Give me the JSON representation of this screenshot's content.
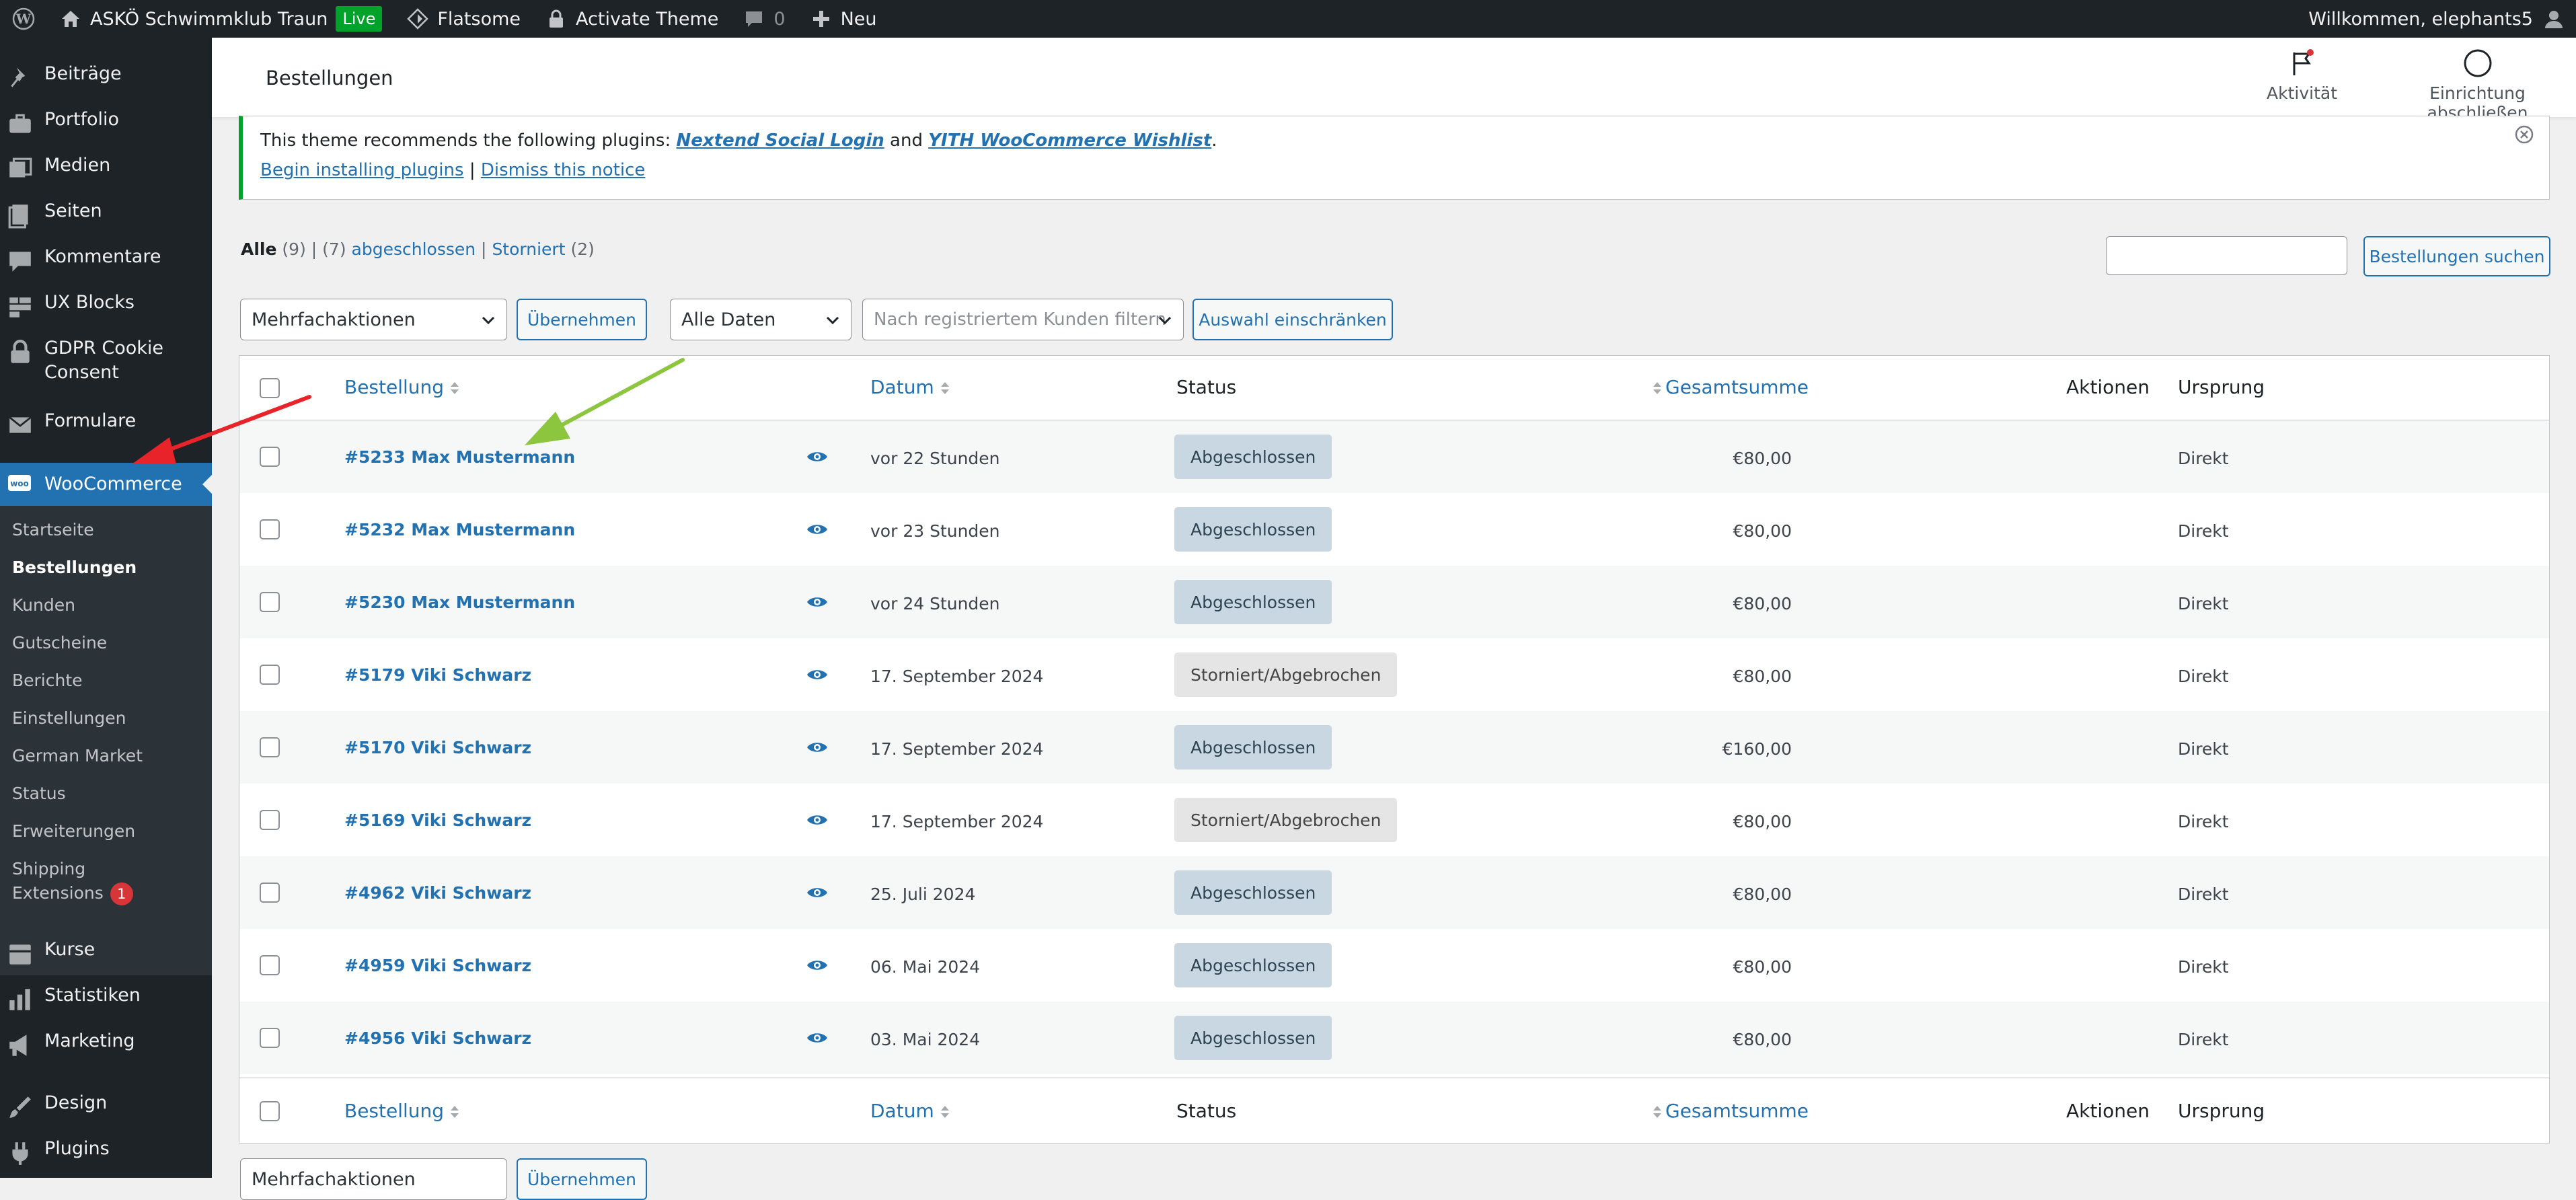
{
  "adminbar": {
    "site_name": "ASKÖ Schwimmklub Traun",
    "live_badge": "Live",
    "theme": "Flatsome",
    "activate_theme": "Activate Theme",
    "comments_count": "0",
    "new_label": "Neu",
    "welcome": "Willkommen, elephants5"
  },
  "sidebar": {
    "items_top": [
      {
        "label": "Beiträge",
        "icon": "pin-icon"
      },
      {
        "label": "Portfolio",
        "icon": "portfolio-icon"
      },
      {
        "label": "Medien",
        "icon": "media-icon"
      },
      {
        "label": "Seiten",
        "icon": "pages-icon"
      },
      {
        "label": "Kommentare",
        "icon": "comments-icon"
      },
      {
        "label": "UX Blocks",
        "icon": "blocks-icon"
      },
      {
        "label": "GDPR Cookie Consent",
        "icon": "lock-icon"
      },
      {
        "label": "Formulare",
        "icon": "mail-icon"
      }
    ],
    "active": {
      "label": "WooCommerce",
      "icon": "woo-icon"
    },
    "submenu": [
      {
        "label": "Startseite"
      },
      {
        "label": "Bestellungen"
      },
      {
        "label": "Kunden"
      },
      {
        "label": "Gutscheine"
      },
      {
        "label": "Berichte"
      },
      {
        "label": "Einstellungen"
      },
      {
        "label": "German Market"
      },
      {
        "label": "Status"
      },
      {
        "label": "Erweiterungen"
      },
      {
        "label": "Shipping Extensions",
        "badge": "1"
      }
    ],
    "items_bottom": [
      {
        "label": "Kurse",
        "icon": "courses-icon"
      },
      {
        "label": "Statistiken",
        "icon": "stats-icon"
      },
      {
        "label": "Marketing",
        "icon": "marketing-icon"
      },
      {
        "label": "Design",
        "icon": "brush-icon"
      },
      {
        "label": "Plugins",
        "icon": "plugin-icon"
      }
    ]
  },
  "header": {
    "title": "Bestellungen",
    "activity": "Aktivität",
    "setup": "Einrichtung abschließen"
  },
  "notice": {
    "text_before": "This theme recommends the following plugins: ",
    "plugin1": "Nextend Social Login",
    "text_and": " and ",
    "plugin2": "YITH WooCommerce Wishlist",
    "text_end": ".",
    "install_link": "Begin installing plugins",
    "separator": " | ",
    "dismiss_link": "Dismiss this notice"
  },
  "filters": {
    "all_label": "Alle",
    "all_count": "(9)",
    "sep": " | ",
    "completed_count": "(7)",
    "completed_label": "abgeschlossen",
    "cancelled_label": "Storniert",
    "cancelled_count": "(2)"
  },
  "search": {
    "button": "Bestellungen suchen",
    "value": ""
  },
  "toolbar": {
    "bulk": "Mehrfachaktionen",
    "apply": "Übernehmen",
    "dates": "Alle Daten",
    "customer_placeholder": "Nach registriertem Kunden filtern",
    "filter": "Auswahl einschränken"
  },
  "table": {
    "columns": {
      "order": "Bestellung",
      "date": "Datum",
      "status": "Status",
      "total": "Gesamtsumme",
      "actions": "Aktionen",
      "origin": "Ursprung"
    },
    "rows": [
      {
        "order": "#5233 Max Mustermann",
        "date": "vor 22 Stunden",
        "status": "Abgeschlossen",
        "status_type": "done",
        "total": "€80,00",
        "origin": "Direkt"
      },
      {
        "order": "#5232 Max Mustermann",
        "date": "vor 23 Stunden",
        "status": "Abgeschlossen",
        "status_type": "done",
        "total": "€80,00",
        "origin": "Direkt"
      },
      {
        "order": "#5230 Max Mustermann",
        "date": "vor 24 Stunden",
        "status": "Abgeschlossen",
        "status_type": "done",
        "total": "€80,00",
        "origin": "Direkt"
      },
      {
        "order": "#5179 Viki Schwarz",
        "date": "17. September 2024",
        "status": "Storniert/Abgebrochen",
        "status_type": "cancel",
        "total": "€80,00",
        "origin": "Direkt"
      },
      {
        "order": "#5170 Viki Schwarz",
        "date": "17. September 2024",
        "status": "Abgeschlossen",
        "status_type": "done",
        "total": "€160,00",
        "origin": "Direkt"
      },
      {
        "order": "#5169 Viki Schwarz",
        "date": "17. September 2024",
        "status": "Storniert/Abgebrochen",
        "status_type": "cancel",
        "total": "€80,00",
        "origin": "Direkt"
      },
      {
        "order": "#4962 Viki Schwarz",
        "date": "25. Juli 2024",
        "status": "Abgeschlossen",
        "status_type": "done",
        "total": "€80,00",
        "origin": "Direkt"
      },
      {
        "order": "#4959 Viki Schwarz",
        "date": "06. Mai 2024",
        "status": "Abgeschlossen",
        "status_type": "done",
        "total": "€80,00",
        "origin": "Direkt"
      },
      {
        "order": "#4956 Viki Schwarz",
        "date": "03. Mai 2024",
        "status": "Abgeschlossen",
        "status_type": "done",
        "total": "€80,00",
        "origin": "Direkt"
      }
    ]
  },
  "colors": {
    "accent": "#2271b1",
    "sidebar_bg": "#1d2327",
    "annotation_red": "#e8232a",
    "annotation_green": "#8cc63f"
  }
}
